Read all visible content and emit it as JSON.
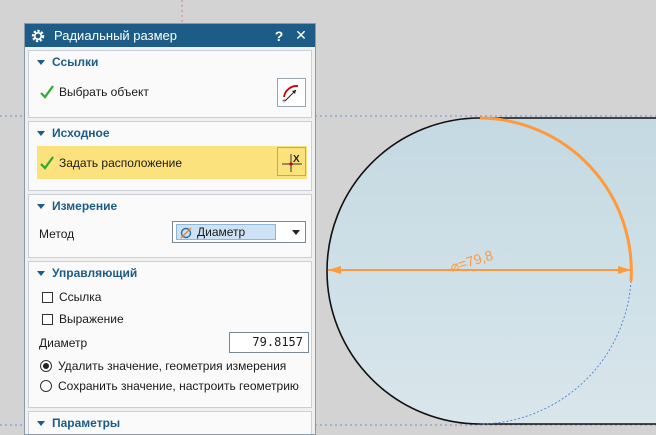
{
  "dialog": {
    "title": "Радиальный размер",
    "help_label": "?",
    "close_label": "✕"
  },
  "sections": {
    "references": {
      "title": "Ссылки",
      "select_object_label": "Выбрать объект"
    },
    "origin": {
      "title": "Исходное",
      "set_location_label": "Задать расположение"
    },
    "measurement": {
      "title": "Измерение",
      "method_label": "Метод",
      "method_value": "Диаметр"
    },
    "driving": {
      "title": "Управляющий",
      "reference_label": "Ссылка",
      "expression_label": "Выражение",
      "diameter_label": "Диаметр",
      "diameter_value": "79.8157",
      "option_remove_label": "Удалить значение, геометрия измерения",
      "option_keep_label": "Сохранить значение, настроить геометрию"
    },
    "settings": {
      "title": "Параметры"
    }
  },
  "viewport": {
    "dimension_label": "⌀=79,8",
    "colors": {
      "accent": "#ff9a3c",
      "circle_fill": "#c9dce4",
      "outline": "#111111"
    }
  }
}
